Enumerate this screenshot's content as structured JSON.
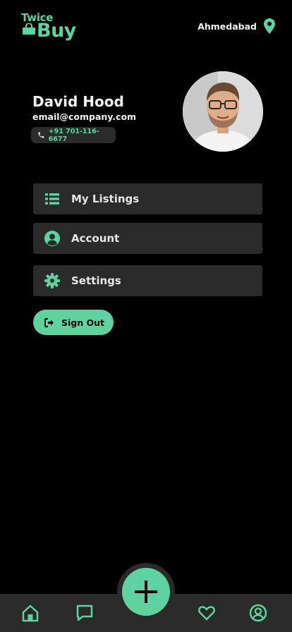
{
  "brand": {
    "name_top": "Twice",
    "name_bottom": "Buy",
    "accent_color": "#5ed3a0"
  },
  "header": {
    "location": "Ahmedabad",
    "location_icon": "map-pin-icon"
  },
  "profile": {
    "name": "David Hood",
    "email": "email@company.com",
    "phone": "+91 701-116-6677",
    "avatar_alt": "profile photo"
  },
  "menu": {
    "items": [
      {
        "label": "My Listings",
        "icon": "list-icon"
      },
      {
        "label": "Account",
        "icon": "user-circle-icon"
      },
      {
        "label": "Settings",
        "icon": "gear-icon"
      }
    ]
  },
  "signout": {
    "label": "Sign Out",
    "icon": "sign-out-icon"
  },
  "bottom_nav": {
    "items": [
      {
        "icon": "home-icon"
      },
      {
        "icon": "chat-icon"
      },
      {
        "icon": "plus-icon"
      },
      {
        "icon": "heart-icon"
      },
      {
        "icon": "profile-icon"
      }
    ],
    "active": "profile-icon"
  }
}
